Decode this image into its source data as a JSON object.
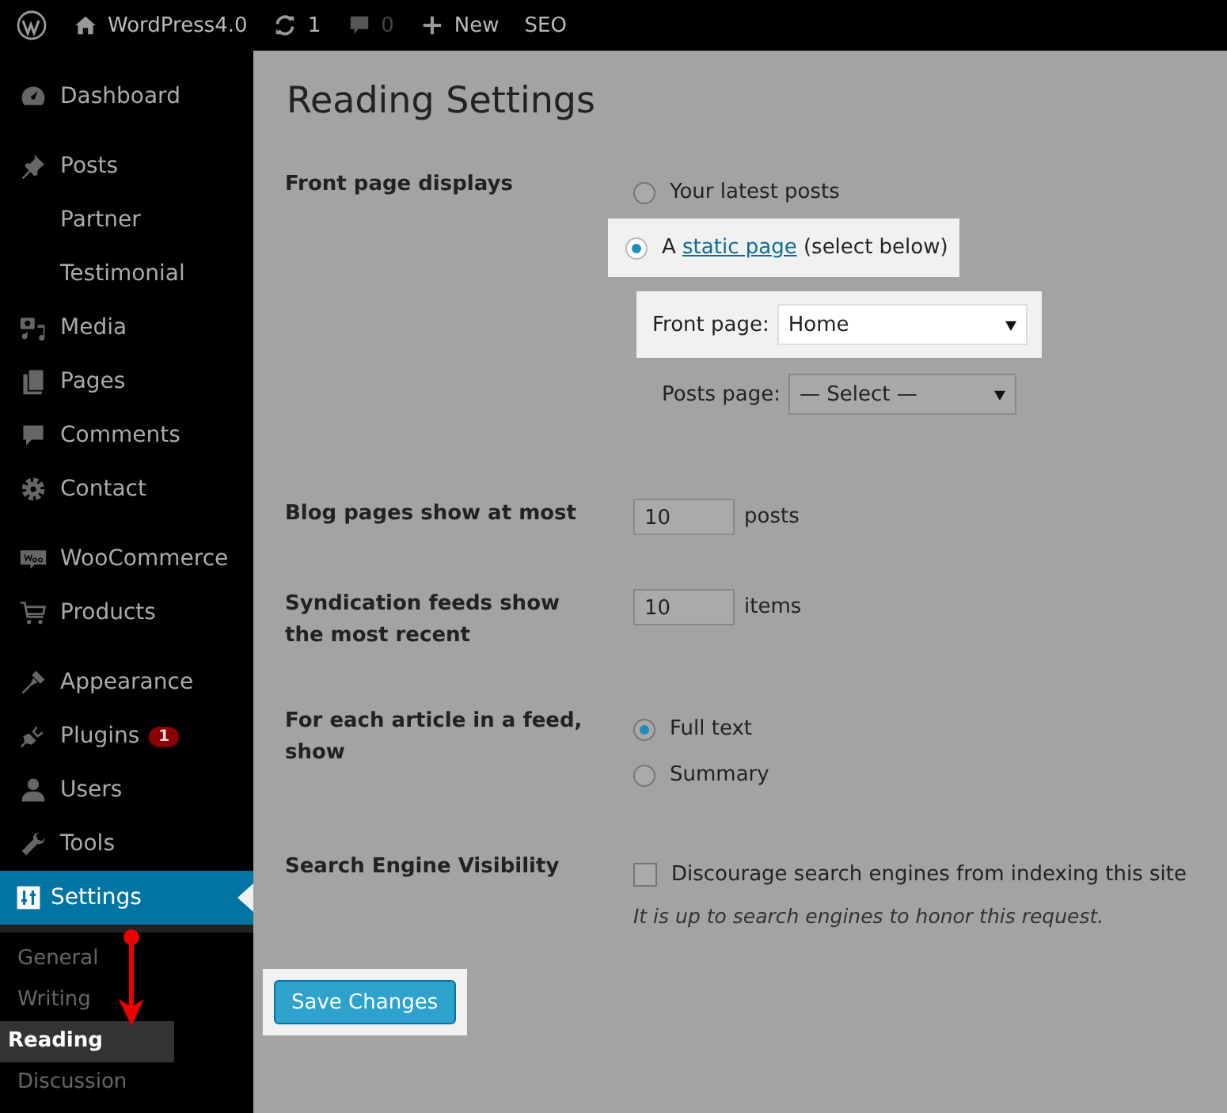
{
  "admin_bar": {
    "items": [
      {
        "kind": "logo"
      },
      {
        "kind": "home",
        "label": "WordPress4.0"
      },
      {
        "kind": "updates",
        "label": "1"
      },
      {
        "kind": "comments",
        "label": "0"
      },
      {
        "kind": "new",
        "label": "New"
      },
      {
        "kind": "text",
        "label": "SEO"
      }
    ]
  },
  "sidebar": {
    "sections": [
      [
        {
          "kind": "dashboard",
          "label": "Dashboard",
          "selected": false
        }
      ],
      [
        {
          "kind": "pin",
          "label": "Posts",
          "selected": false
        },
        {
          "kind": "none",
          "label": "Partner",
          "selected": false
        },
        {
          "kind": "none",
          "label": "Testimonial",
          "selected": false
        },
        {
          "kind": "media",
          "label": "Media",
          "selected": false
        },
        {
          "kind": "pages",
          "label": "Pages",
          "selected": false
        },
        {
          "kind": "comments",
          "label": "Comments",
          "selected": false
        },
        {
          "kind": "gear",
          "label": "Contact",
          "selected": false
        }
      ],
      [
        {
          "kind": "woo",
          "label": "WooCommerce",
          "selected": false
        },
        {
          "kind": "cart",
          "label": "Products",
          "selected": false
        }
      ],
      [
        {
          "kind": "brush",
          "label": "Appearance",
          "selected": false
        },
        {
          "kind": "plug",
          "label": "Plugins",
          "badge": "1",
          "selected": false
        },
        {
          "kind": "user",
          "label": "Users",
          "selected": false
        },
        {
          "kind": "wrench",
          "label": "Tools",
          "selected": false
        },
        {
          "kind": "sliders",
          "label": "Settings",
          "selected": true,
          "children": [
            {
              "label": "General",
              "selected": false
            },
            {
              "label": "Writing",
              "selected": false
            },
            {
              "label": "Reading",
              "selected": true
            },
            {
              "label": "Discussion",
              "selected": false
            }
          ]
        }
      ]
    ]
  },
  "page": {
    "title": "Reading Settings",
    "rows": [
      {
        "kind": "front_page",
        "label": "Front page displays",
        "options": [
          {
            "text": "Your latest posts",
            "selected": false,
            "highlighted": false
          },
          {
            "prefix": "A ",
            "link": "static page",
            "text": "(select below)",
            "selected": true,
            "highlighted": true
          }
        ],
        "selects": [
          {
            "label": "Front page:",
            "value": "Home",
            "highlighted": true
          },
          {
            "label": "Posts page:",
            "value": "— Select —",
            "highlighted": false
          }
        ]
      },
      {
        "kind": "number",
        "label": "Blog pages show at most",
        "value": "10",
        "unit": "posts"
      },
      {
        "kind": "number",
        "label": "Syndication feeds show the most recent",
        "value": "10",
        "unit": "items"
      },
      {
        "kind": "radio",
        "label": "For each article in a feed, show",
        "options": [
          {
            "text": "Full text",
            "selected": true
          },
          {
            "text": "Summary",
            "selected": false
          }
        ]
      },
      {
        "kind": "checkbox",
        "label": "Search Engine Visibility",
        "text": "Discourage search engines from indexing this site",
        "checked": false,
        "note": "It is up to search engines to honor this request."
      }
    ],
    "save_button": {
      "label": "Save Changes",
      "highlighted": true
    }
  }
}
